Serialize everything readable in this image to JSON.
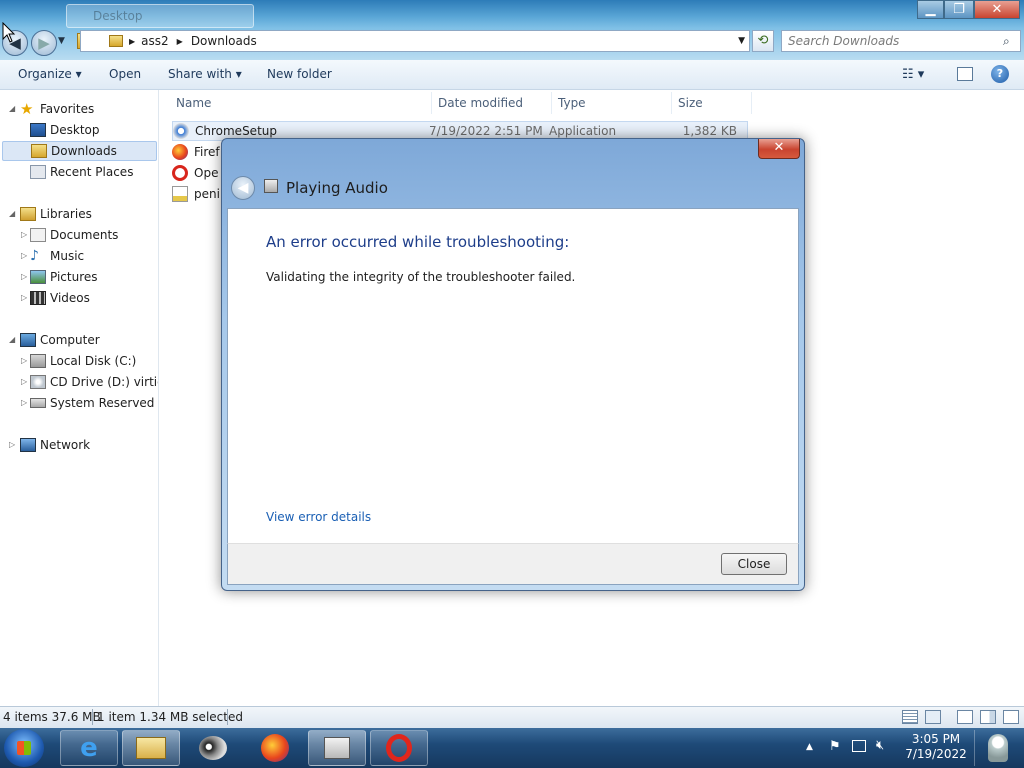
{
  "window": {
    "ghost_tab": "Desktop",
    "minimize": "▁",
    "maximize": "❐",
    "close": "✕"
  },
  "address": {
    "crumbs": [
      "ass2",
      "Downloads"
    ],
    "search_placeholder": "Search Downloads"
  },
  "toolbar": {
    "organize": "Organize",
    "open": "Open",
    "share_with": "Share with",
    "new_folder": "New folder"
  },
  "nav": {
    "favorites": "Favorites",
    "desktop": "Desktop",
    "downloads": "Downloads",
    "recent": "Recent Places",
    "libraries": "Libraries",
    "documents": "Documents",
    "music": "Music",
    "pictures": "Pictures",
    "videos": "Videos",
    "computer": "Computer",
    "local_disk": "Local Disk (C:)",
    "cd_drive": "CD Drive (D:) virtio-w",
    "sys_reserved": "System Reserved (E:)",
    "network": "Network"
  },
  "columns": {
    "name": "Name",
    "date": "Date modified",
    "type": "Type",
    "size": "Size"
  },
  "files": [
    {
      "name": "ChromeSetup",
      "date": "7/19/2022 2:51 PM",
      "type": "Application",
      "size": "1,382 KB"
    },
    {
      "name": "Firef"
    },
    {
      "name": "Ope"
    },
    {
      "name": "peni"
    }
  ],
  "status": {
    "items": "4 items 37.6 MB",
    "selected": "1 item 1.34 MB selected"
  },
  "clock": {
    "time": "3:05 PM",
    "date": "7/19/2022"
  },
  "dialog": {
    "title": "Playing Audio",
    "close_x": "✕",
    "heading": "An error occurred while troubleshooting:",
    "message": "Validating the integrity of the troubleshooter failed.",
    "link": "View error details",
    "close_button": "Close"
  }
}
